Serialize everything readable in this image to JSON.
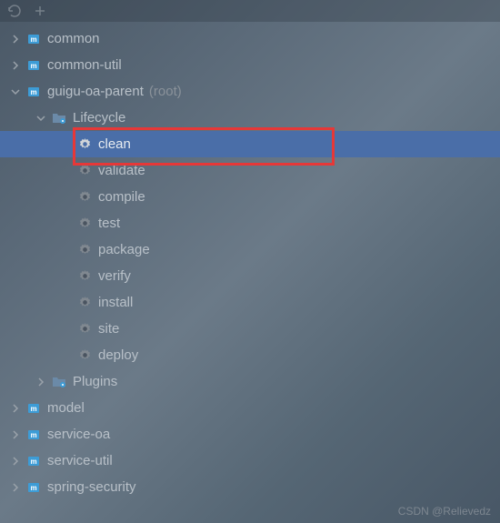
{
  "toolbar": {},
  "tree": {
    "items": [
      {
        "label": "common",
        "icon": "maven-module",
        "expand": "collapsed",
        "depth": 1
      },
      {
        "label": "common-util",
        "icon": "maven-module",
        "expand": "collapsed",
        "depth": 1
      },
      {
        "label": "guigu-oa-parent",
        "suffix": "(root)",
        "icon": "maven-module",
        "expand": "expanded",
        "depth": 1
      },
      {
        "label": "Lifecycle",
        "icon": "folder-gear",
        "expand": "expanded",
        "depth": 2
      },
      {
        "label": "clean",
        "icon": "gear",
        "expand": "none",
        "depth": 3,
        "selected": true
      },
      {
        "label": "validate",
        "icon": "gear",
        "expand": "none",
        "depth": 3
      },
      {
        "label": "compile",
        "icon": "gear",
        "expand": "none",
        "depth": 3
      },
      {
        "label": "test",
        "icon": "gear",
        "expand": "none",
        "depth": 3
      },
      {
        "label": "package",
        "icon": "gear",
        "expand": "none",
        "depth": 3
      },
      {
        "label": "verify",
        "icon": "gear",
        "expand": "none",
        "depth": 3
      },
      {
        "label": "install",
        "icon": "gear",
        "expand": "none",
        "depth": 3
      },
      {
        "label": "site",
        "icon": "gear",
        "expand": "none",
        "depth": 3
      },
      {
        "label": "deploy",
        "icon": "gear",
        "expand": "none",
        "depth": 3
      },
      {
        "label": "Plugins",
        "icon": "folder-gear",
        "expand": "collapsed",
        "depth": 2
      },
      {
        "label": "model",
        "icon": "maven-module",
        "expand": "collapsed",
        "depth": 1
      },
      {
        "label": "service-oa",
        "icon": "maven-module",
        "expand": "collapsed",
        "depth": 1
      },
      {
        "label": "service-util",
        "icon": "maven-module",
        "expand": "collapsed",
        "depth": 1
      },
      {
        "label": "spring-security",
        "icon": "maven-module",
        "expand": "collapsed",
        "depth": 1
      }
    ]
  },
  "watermark": "CSDN @Relievedz",
  "colors": {
    "selection": "#4a6ea8",
    "highlight_border": "#e63838",
    "maven_blue": "#3d9cd6",
    "gear_gray": "#808890"
  }
}
